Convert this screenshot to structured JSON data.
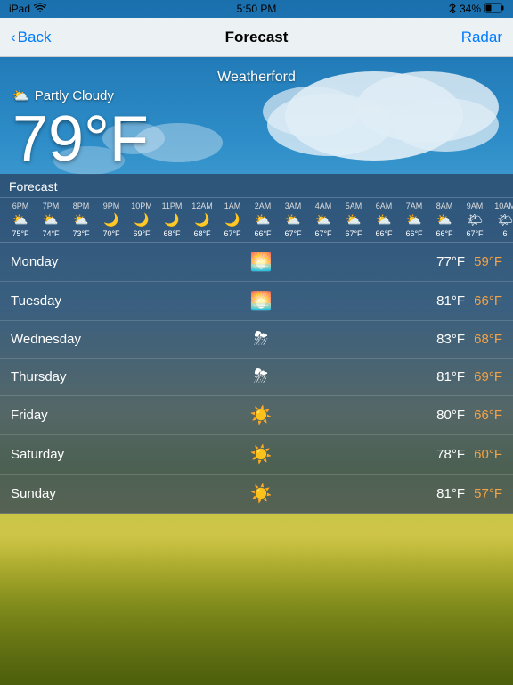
{
  "statusBar": {
    "carrier": "iPad",
    "signal": "wifi",
    "time": "5:50 PM",
    "bluetooth": "BT",
    "battery": "34%"
  },
  "navBar": {
    "backLabel": "Back",
    "title": "Forecast",
    "radarLabel": "Radar"
  },
  "city": "Weatherford",
  "currentWeather": {
    "condition": "Partly Cloudy",
    "temp": "79°F",
    "icon": "⛅"
  },
  "forecastLabel": "Forecast",
  "hourly": [
    {
      "time": "6PM",
      "icon": "⛅",
      "temp": "75°F"
    },
    {
      "time": "7PM",
      "icon": "⛅",
      "temp": "74°F"
    },
    {
      "time": "8PM",
      "icon": "⛅",
      "temp": "73°F"
    },
    {
      "time": "9PM",
      "icon": "🌙",
      "temp": "70°F"
    },
    {
      "time": "10PM",
      "icon": "🌙",
      "temp": "69°F"
    },
    {
      "time": "11PM",
      "icon": "🌙",
      "temp": "68°F"
    },
    {
      "time": "12AM",
      "icon": "🌙",
      "temp": "68°F"
    },
    {
      "time": "1AM",
      "icon": "🌙",
      "temp": "67°F"
    },
    {
      "time": "2AM",
      "icon": "⛅",
      "temp": "66°F"
    },
    {
      "time": "3AM",
      "icon": "⛅",
      "temp": "67°F"
    },
    {
      "time": "4AM",
      "icon": "⛅",
      "temp": "67°F"
    },
    {
      "time": "5AM",
      "icon": "⛅",
      "temp": "67°F"
    },
    {
      "time": "6AM",
      "icon": "⛅",
      "temp": "66°F"
    },
    {
      "time": "7AM",
      "icon": "⛅",
      "temp": "66°F"
    },
    {
      "time": "8AM",
      "icon": "⛅",
      "temp": "66°F"
    },
    {
      "time": "9AM",
      "icon": "🌤",
      "temp": "67°F"
    },
    {
      "time": "10AM",
      "icon": "🌤",
      "temp": "6"
    }
  ],
  "daily": [
    {
      "day": "Monday",
      "icon": "🌅",
      "high": "77°F",
      "low": "59°F"
    },
    {
      "day": "Tuesday",
      "icon": "🌅",
      "high": "81°F",
      "low": "66°F"
    },
    {
      "day": "Wednesday",
      "icon": "⛈",
      "high": "83°F",
      "low": "68°F"
    },
    {
      "day": "Thursday",
      "icon": "⛈",
      "high": "81°F",
      "low": "69°F"
    },
    {
      "day": "Friday",
      "icon": "☀️",
      "high": "80°F",
      "low": "66°F"
    },
    {
      "day": "Saturday",
      "icon": "☀️",
      "high": "78°F",
      "low": "60°F"
    },
    {
      "day": "Sunday",
      "icon": "☀️",
      "high": "81°F",
      "low": "57°F"
    }
  ]
}
